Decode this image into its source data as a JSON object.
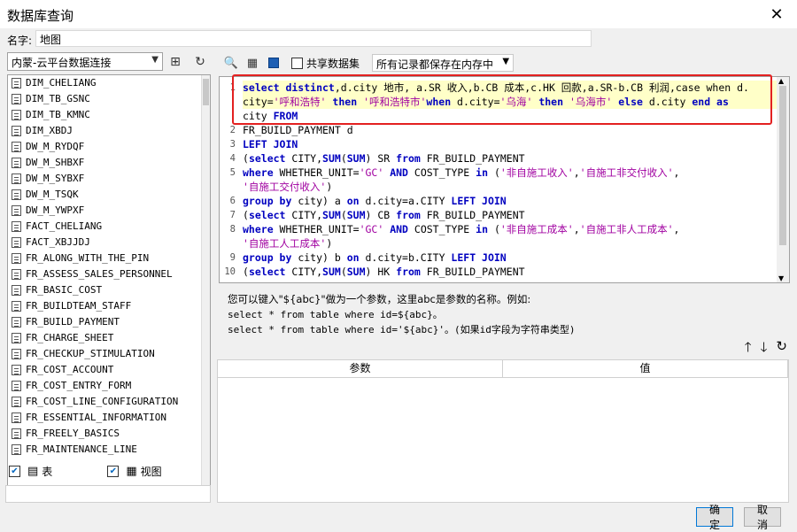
{
  "window": {
    "title": "数据库查询",
    "close_icon": "✕"
  },
  "name_row": {
    "label": "名字:",
    "value": "地图"
  },
  "left": {
    "datasource": "内蒙-云平台数据连接",
    "tables": [
      "DIM_CHELIANG",
      "DIM_TB_GSNC",
      "DIM_TB_KMNC",
      "DIM_XBDJ",
      "DW_M_RYDQF",
      "DW_M_SHBXF",
      "DW_M_SYBXF",
      "DW_M_TSQK",
      "DW_M_YWPXF",
      "FACT_CHELIANG",
      "FACT_XBJJDJ",
      "FR_ALONG_WITH_THE_PIN",
      "FR_ASSESS_SALES_PERSONNEL",
      "FR_BASIC_COST",
      "FR_BUILDTEAM_STAFF",
      "FR_BUILD_PAYMENT",
      "FR_CHARGE_SHEET",
      "FR_CHECKUP_STIMULATION",
      "FR_COST_ACCOUNT",
      "FR_COST_ENTRY_FORM",
      "FR_COST_LINE_CONFIGURATION",
      "FR_ESSENTIAL_INFORMATION",
      "FR_FREELY_BASICS",
      "FR_MAINTENANCE_LINE"
    ],
    "check_table": "表",
    "check_view": "视图"
  },
  "right": {
    "share_label": "共享数据集",
    "mem_select": "所有记录都保存在内存中",
    "code_lines": [
      {
        "n": "1",
        "html": "<span class=\"kw\">select distinct</span>,d.city 地市, a.SR 收入,b.CB 成本,c.HK 回款,a.SR-b.CB 利润,case when d.",
        "hl": true
      },
      {
        "n": "",
        "html": "city=<span class=\"str\">'呼和浩特'</span> <span class=\"kw\">then</span> <span class=\"str\">'呼和浩特市'</span><span class=\"kw\">when</span> d.city=<span class=\"str\">'乌海'</span> <span class=\"kw\">then</span> <span class=\"str\">'乌海市'</span> <span class=\"kw\">else</span> d.city <span class=\"kw\">end as</span>",
        "hl": true
      },
      {
        "n": "",
        "html": "city <span class=\"kw\">FROM</span>",
        "hl": false
      },
      {
        "n": "2",
        "html": "FR_BUILD_PAYMENT d",
        "hl": false
      },
      {
        "n": "3",
        "html": "<span class=\"kw\">LEFT JOIN</span>",
        "hl": false
      },
      {
        "n": "4",
        "html": "(<span class=\"kw\">select</span> CITY,<span class=\"kw\">SUM</span>(<span class=\"kw\">SUM</span>) SR <span class=\"kw\">from</span> FR_BUILD_PAYMENT",
        "hl": false
      },
      {
        "n": "5",
        "html": "<span class=\"kw\">where</span> WHETHER_UNIT=<span class=\"str\">'GC'</span> <span class=\"kw\">AND</span> COST_TYPE <span class=\"kw\">in</span> (<span class=\"str\">'非自施工收入'</span>,<span class=\"str\">'自施工非交付收入'</span>,",
        "hl": false
      },
      {
        "n": "",
        "html": "<span class=\"str\">'自施工交付收入'</span>)",
        "hl": false
      },
      {
        "n": "6",
        "html": "<span class=\"kw\">group by</span> city) a <span class=\"kw\">on</span> d.city=a.CITY <span class=\"kw\">LEFT JOIN</span>",
        "hl": false
      },
      {
        "n": "7",
        "html": "(<span class=\"kw\">select</span> CITY,<span class=\"kw\">SUM</span>(<span class=\"kw\">SUM</span>) CB <span class=\"kw\">from</span> FR_BUILD_PAYMENT",
        "hl": false
      },
      {
        "n": "8",
        "html": "<span class=\"kw\">where</span> WHETHER_UNIT=<span class=\"str\">'GC'</span> <span class=\"kw\">AND</span> COST_TYPE <span class=\"kw\">in</span> (<span class=\"str\">'非自施工成本'</span>,<span class=\"str\">'自施工非人工成本'</span>,",
        "hl": false
      },
      {
        "n": "",
        "html": "<span class=\"str\">'自施工人工成本'</span>)",
        "hl": false
      },
      {
        "n": "9",
        "html": "<span class=\"kw\">group by</span> city) b <span class=\"kw\">on</span> d.city=b.CITY <span class=\"kw\">LEFT JOIN</span>",
        "hl": false
      },
      {
        "n": "10",
        "html": "(<span class=\"kw\">select</span> CITY,<span class=\"kw\">SUM</span>(<span class=\"kw\">SUM</span>) HK <span class=\"kw\">from</span> FR_BUILD_PAYMENT",
        "hl": false
      }
    ],
    "hint_line1": "您可以键入\"${abc}\"做为一个参数，这里abc是参数的名称。例如:",
    "hint_line2": "select * from table where id=${abc}。",
    "hint_line3": "select * from table where id='${abc}'。(如果id字段为字符串类型)",
    "param_col_name": "参数",
    "param_col_value": "值"
  },
  "footer": {
    "ok": "确定",
    "cancel": "取消"
  }
}
